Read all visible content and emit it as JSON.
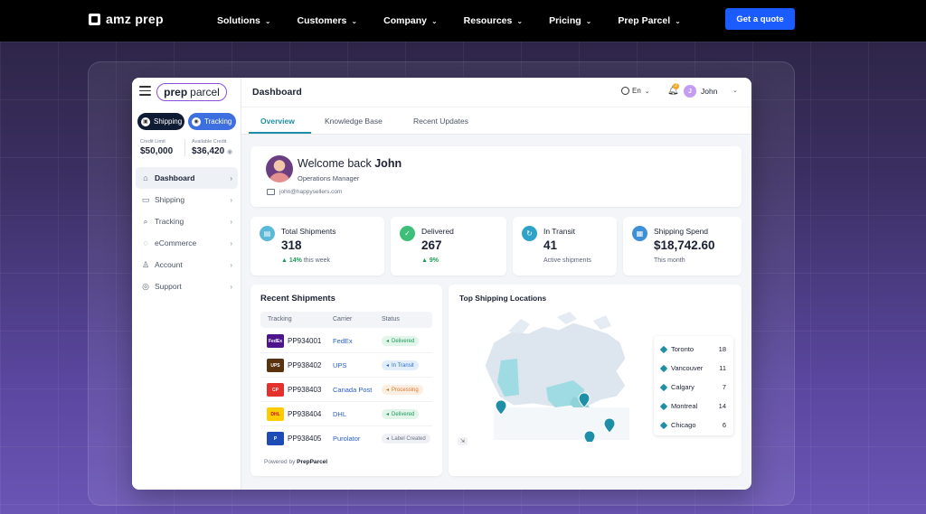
{
  "topnav": {
    "brand": "amz prep",
    "links": [
      "Solutions",
      "Customers",
      "Company",
      "Resources",
      "Pricing",
      "Prep Parcel"
    ],
    "cta": "Get a quote"
  },
  "app": {
    "brand_bold": "prep",
    "brand_light": "parcel",
    "modes": [
      "Shipping",
      "Tracking"
    ],
    "credit": {
      "limit_label": "Credit Limit",
      "limit_value": "$50,000",
      "available_label": "Available Credit",
      "available_value": "$36,420"
    },
    "nav": [
      {
        "label": "Dashboard",
        "icon": "home-icon"
      },
      {
        "label": "Shipping",
        "icon": "folder-icon"
      },
      {
        "label": "Tracking",
        "icon": "route-icon"
      },
      {
        "label": "eCommerce",
        "icon": "cart-icon"
      },
      {
        "label": "Account",
        "icon": "user-icon"
      },
      {
        "label": "Support",
        "icon": "support-icon"
      }
    ],
    "header": {
      "title": "Dashboard",
      "lang": "En",
      "notif_count": "2",
      "user_initial": "J",
      "user": "John"
    },
    "tabs": [
      "Overview",
      "Knowledge Base",
      "Recent Updates"
    ],
    "welcome": {
      "greet": "Welcome back",
      "name": "John",
      "role": "Operations Manager",
      "email": "john@happysellers.com"
    },
    "stats": [
      {
        "label": "Total Shipments",
        "value": "318",
        "trend": "14%",
        "sub": "this week",
        "color": "#5bb8d6"
      },
      {
        "label": "Delivered",
        "value": "267",
        "trend": "9%",
        "sub": "",
        "color": "#3dbf7a"
      },
      {
        "label": "In Transit",
        "value": "41",
        "trend": "",
        "sub": "Active shipments",
        "color": "#2ea3c7"
      },
      {
        "label": "Shipping Spend",
        "value": "$18,742.60",
        "trend": "",
        "sub": "This month",
        "color": "#3d8fd6"
      }
    ],
    "recent": {
      "title": "Recent Shipments",
      "columns": [
        "Tracking",
        "Carrier",
        "Status"
      ],
      "rows": [
        {
          "tracking": "PP934001",
          "carrier": "FedEx",
          "status": "Delivered",
          "logo": "FedEx",
          "logo_color": "#4d148c"
        },
        {
          "tracking": "PP938402",
          "carrier": "UPS",
          "status": "In Transit",
          "logo": "UPS",
          "logo_color": "#5a3210"
        },
        {
          "tracking": "PP938403",
          "carrier": "Canada Post",
          "status": "Processing",
          "logo": "CP",
          "logo_color": "#e3312d"
        },
        {
          "tracking": "PP938404",
          "carrier": "DHL",
          "status": "Delivered",
          "logo": "DHL",
          "logo_color": "#ffcc00"
        },
        {
          "tracking": "PP938405",
          "carrier": "Purolator",
          "status": "Label Created",
          "logo": "P",
          "logo_color": "#1e4bb5"
        }
      ],
      "powered_pre": "Powered by",
      "powered_brand": "PrepParcel"
    },
    "map": {
      "title": "Top Shipping Locations",
      "locations": [
        {
          "city": "Toronto",
          "count": "18"
        },
        {
          "city": "Vancouver",
          "count": "11"
        },
        {
          "city": "Calgary",
          "count": "7"
        },
        {
          "city": "Montreal",
          "count": "14"
        },
        {
          "city": "Chicago",
          "count": "6"
        }
      ]
    }
  }
}
